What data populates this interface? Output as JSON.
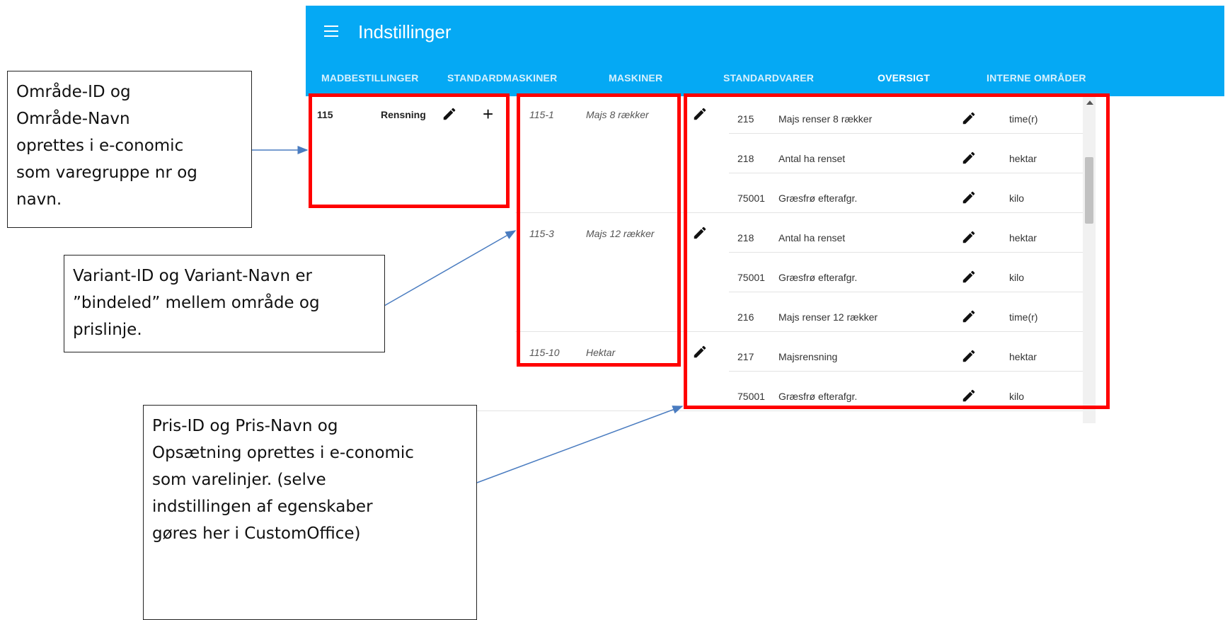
{
  "app": {
    "title": "Indstillinger",
    "tabs": [
      "MADBESTILLINGER",
      "STANDARDMASKINER",
      "MASKINER",
      "STANDARDVARER",
      "OVERSIGT",
      "INTERNE OMRÅDER"
    ],
    "active_tab": "OVERSIGT"
  },
  "area": {
    "id": "115",
    "name": "Rensning"
  },
  "variants": [
    {
      "id": "115-1",
      "name": "Majs 8 rækker"
    },
    {
      "id": "115-3",
      "name": "Majs 12 rækker"
    },
    {
      "id": "115-10",
      "name": "Hektar"
    }
  ],
  "prices": [
    {
      "id": "215",
      "name": "Majs renser 8 rækker",
      "unit": "time(r)"
    },
    {
      "id": "218",
      "name": "Antal ha renset",
      "unit": "hektar"
    },
    {
      "id": "75001",
      "name": "Græsfrø efterafgr.",
      "unit": "kilo"
    },
    {
      "id": "218",
      "name": "Antal ha renset",
      "unit": "hektar"
    },
    {
      "id": "75001",
      "name": "Græsfrø efterafgr.",
      "unit": "kilo"
    },
    {
      "id": "216",
      "name": "Majs renser 12 rækker",
      "unit": "time(r)"
    },
    {
      "id": "217",
      "name": "Majsrensning",
      "unit": "hektar"
    },
    {
      "id": "75001",
      "name": "Græsfrø efterafgr.",
      "unit": "kilo"
    }
  ],
  "callouts": {
    "area": "Område-ID og\nOmråde-Navn\noprettes i e-conomic\nsom varegruppe nr og\nnavn.",
    "variant": "Variant-ID og Variant-Navn  er\n”bindeled” mellem område og\nprislinje.",
    "price": "Pris-ID og Pris-Navn og\nOpsætning oprettes i e-conomic\nsom varelinjer. (selve\nindstillingen af egenskaber\ngøres her i  CustomOffice)"
  },
  "colors": {
    "appbar": "#05a9f4",
    "highlight": "#ff0000",
    "arrow": "#4a7cc0"
  },
  "icons": [
    "menu-icon",
    "pencil-icon",
    "plus-icon",
    "scroll-up-arrow-icon"
  ]
}
